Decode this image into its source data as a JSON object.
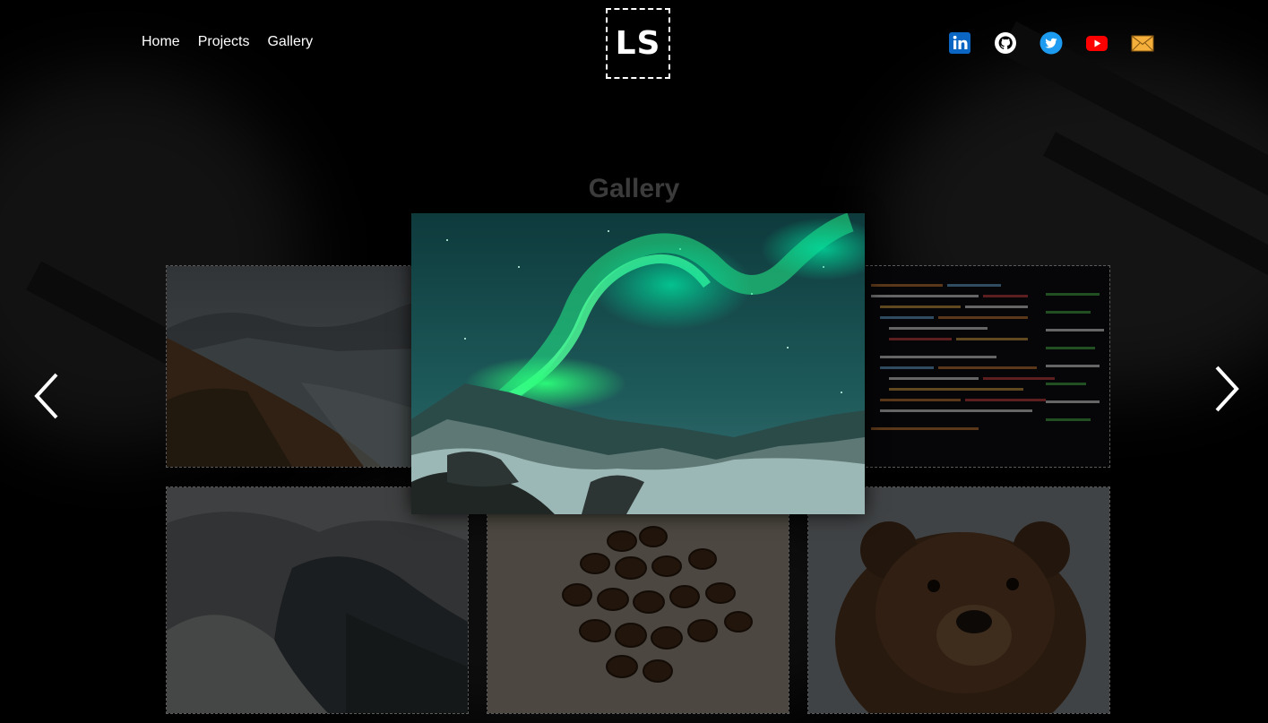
{
  "nav": {
    "items": [
      "Home",
      "Projects",
      "Gallery"
    ]
  },
  "logo": {
    "text": "LS"
  },
  "social": [
    "linkedin-icon",
    "github-icon",
    "twitter-icon",
    "youtube-icon",
    "email-icon"
  ],
  "page": {
    "title": "Gallery"
  },
  "gallery": {
    "tiles": [
      "mountain-valley-photo",
      "code-screen-photo",
      "misty-forest-photo",
      "coffee-beans-photo",
      "bear-photo"
    ]
  },
  "lightbox": {
    "image": "aurora-borealis-photo"
  },
  "colors": {
    "background": "#000000",
    "title": "#3c3c3c",
    "linkedin": "#0a66c2",
    "twitter": "#1d9bf0",
    "youtube": "#ff0000",
    "email": "#f5b03c"
  }
}
